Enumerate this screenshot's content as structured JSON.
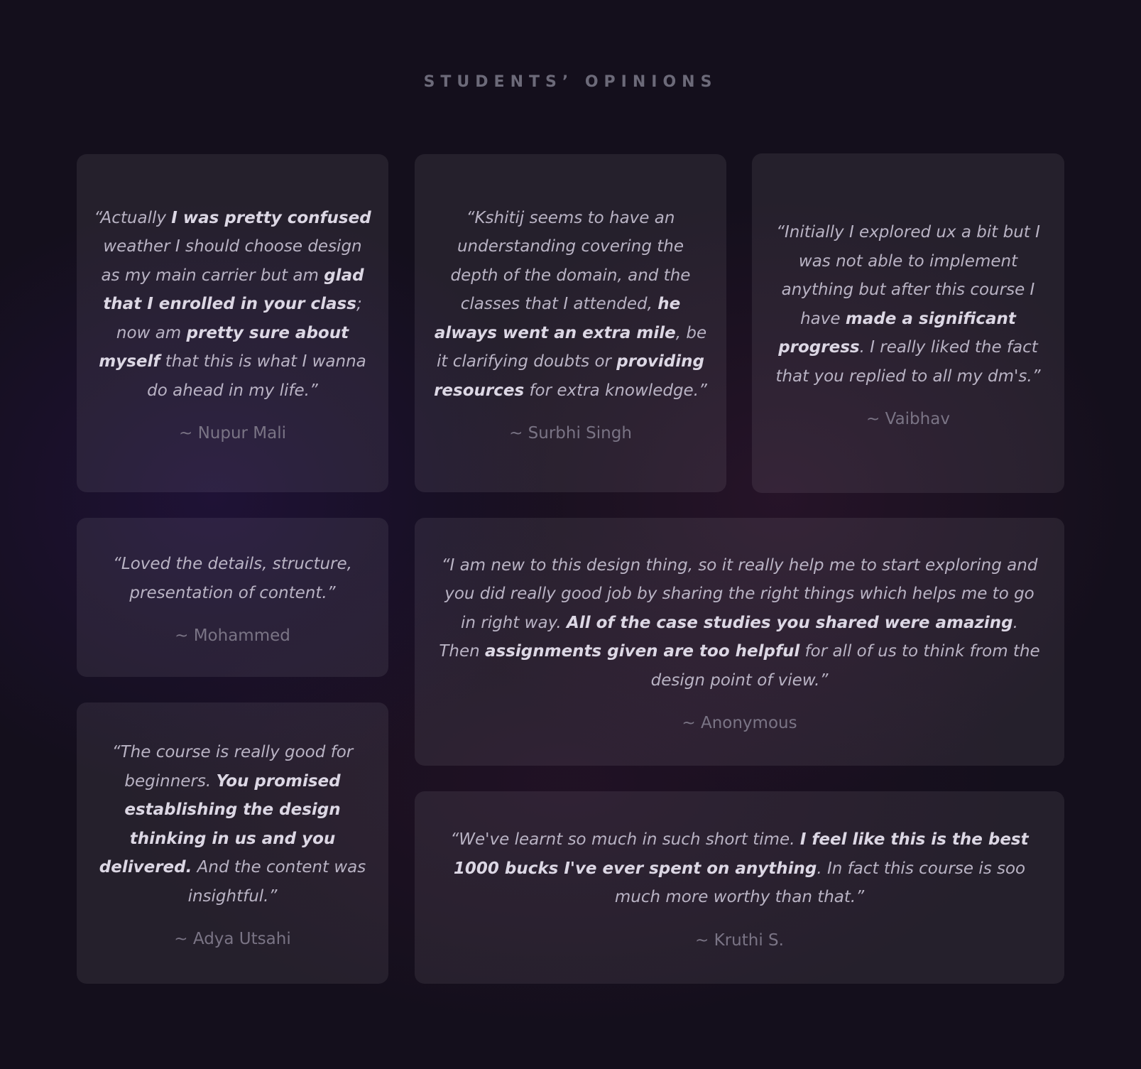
{
  "section": {
    "title": "STUDENTS’ OPINIONS"
  },
  "testimonials": [
    {
      "segments": [
        {
          "t": "“Actually "
        },
        {
          "t": "I was pretty confused",
          "b": true
        },
        {
          "t": " weather I should choose design as my main carrier but am "
        },
        {
          "t": "glad that I enrolled in your class",
          "b": true
        },
        {
          "t": "; now am "
        },
        {
          "t": "pretty sure about myself",
          "b": true
        },
        {
          "t": " that this is what I wanna do ahead in my life.”"
        }
      ],
      "author": "~ Nupur Mali"
    },
    {
      "segments": [
        {
          "t": "“Kshitij seems to have an understanding covering the depth of the domain, and the classes that I attended, "
        },
        {
          "t": "he always went an extra mile",
          "b": true
        },
        {
          "t": ", be it clarifying doubts or "
        },
        {
          "t": "providing resources",
          "b": true
        },
        {
          "t": " for extra knowledge.”"
        }
      ],
      "author": "~ Surbhi Singh"
    },
    {
      "segments": [
        {
          "t": "“Initially I explored ux a bit but I was not able to implement anything but after this course I have "
        },
        {
          "t": "made a significant progress",
          "b": true
        },
        {
          "t": ". I really liked the fact that you replied to all my dm's.”"
        }
      ],
      "author": "~ Vaibhav"
    },
    {
      "segments": [
        {
          "t": "“Loved the details, structure, presentation of content.”"
        }
      ],
      "author": "~ Mohammed"
    },
    {
      "segments": [
        {
          "t": "“I am new to this design thing, so it really help me to start exploring and you did really good job by sharing the right things which helps me to go in right way. "
        },
        {
          "t": "All of the case studies you shared were amazing",
          "b": true
        },
        {
          "t": ". Then "
        },
        {
          "t": "assignments given are too helpful",
          "b": true
        },
        {
          "t": " for all of us to think from the design point of view.”"
        }
      ],
      "author": "~ Anonymous"
    },
    {
      "segments": [
        {
          "t": "“The course is really good for beginners. "
        },
        {
          "t": "You promised establishing the design thinking in us and you delivered.",
          "b": true
        },
        {
          "t": " And the content was insightful.”"
        }
      ],
      "author": "~ Adya Utsahi"
    },
    {
      "segments": [
        {
          "t": "“We've learnt so much in such short time. "
        },
        {
          "t": "I feel like this is the best 1000 bucks I've ever spent on anything",
          "b": true
        },
        {
          "t": ". In fact this course is soo much more worthy than that.”"
        }
      ],
      "author": "~ Kruthi S."
    }
  ]
}
